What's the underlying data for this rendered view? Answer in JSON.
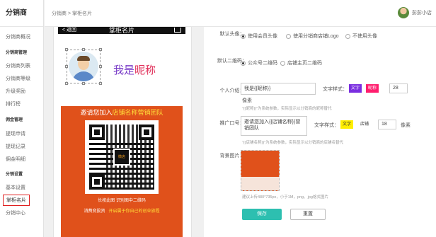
{
  "sidebar": {
    "title": "分销商",
    "items": [
      {
        "label": "分销商概况",
        "group": false
      },
      {
        "label": "分销商管理",
        "group": true
      },
      {
        "label": "分销商列表",
        "group": false
      },
      {
        "label": "分销商等级",
        "group": false
      },
      {
        "label": "升级奖励",
        "group": false
      },
      {
        "label": "排行榜",
        "group": false
      },
      {
        "label": "佣金管理",
        "group": true
      },
      {
        "label": "提现申请",
        "group": false
      },
      {
        "label": "提现记录",
        "group": false
      },
      {
        "label": "佣金明细",
        "group": false
      },
      {
        "label": "分销设置",
        "group": true
      },
      {
        "label": "基本设置",
        "group": false
      },
      {
        "label": "掌柜名片",
        "group": false,
        "active": true
      },
      {
        "label": "分销中心",
        "group": false
      }
    ]
  },
  "header": {
    "breadcrumb": "分销商 > 掌柜名片",
    "user_name": "彭彭小店"
  },
  "preview": {
    "back": "< 返回",
    "title": "掌柜名片",
    "nickname_prefix": "我是",
    "nickname_highlight": "昵称",
    "poster_line1_a": "邀请您加入",
    "poster_line1_b": "店铺名称",
    "poster_line1_c": "营销团队",
    "qr_logo": "微店",
    "poster_line2": "长按此图 识别图中二维码",
    "poster_line3_a": "消费变投资",
    "poster_line3_b": "开启属于你自己的创业旅程"
  },
  "form": {
    "avatar_label": "默认头像：",
    "avatar_options": [
      "使用会员头像",
      "使用分销商店铺Logo",
      "不使用头像"
    ],
    "avatar_selected": 0,
    "qrcode_label": "默认二维码：",
    "qrcode_options": [
      "公众号二维码",
      "店铺主页二维码"
    ],
    "qrcode_selected": 0,
    "intro_label": "个人介绍：",
    "intro_value": "我是{{昵称}}",
    "intro_style_label": "文字样式：",
    "intro_swatch_text": "文字",
    "intro_swatch_nick": "昵称",
    "intro_size": "28",
    "intro_unit": "像素",
    "intro_hint": "“{{昵称}}”为系统参数，实际显示以分销商的昵称替代",
    "promo_label": "推广口号：",
    "promo_value": "邀请您加入{{店铺名称}}营销团队",
    "promo_style_label": "文字样式：",
    "promo_swatch_text": "文字",
    "promo_swatch_shop": "店铺",
    "promo_size": "18",
    "promo_unit": "像素",
    "promo_hint": "“{{店铺名称}}”为系统参数，实际显示以分销商的店铺名替代",
    "bg_label": "背景图片：",
    "bg_hint": "建议上传480*735px，小于1M，png、jpg格式图片",
    "save": "保存",
    "reset": "重置"
  },
  "colors": {
    "accent": "#2dbfb0",
    "poster": "#e0511b",
    "swatch_text_bg": "#7a2ee0",
    "swatch_nick_bg": "#ff1e6e",
    "swatch_promo_bg": "#ffee00",
    "active_border": "#e02020"
  }
}
